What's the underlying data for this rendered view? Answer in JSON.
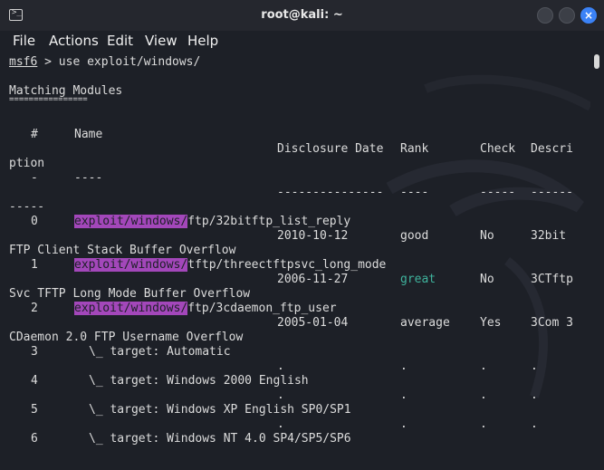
{
  "window": {
    "title": "root@kali: ~"
  },
  "menu": [
    "File",
    "Actions",
    "Edit",
    "View",
    "Help"
  ],
  "terminal": {
    "prompt": "msf6",
    "command": " > use exploit/windows/",
    "heading": "Matching Modules",
    "heading_rule": "================",
    "highlight": "exploit/windows/",
    "header1": [
      "#",
      "Name"
    ],
    "header2": [
      "Disclosure Date",
      "Rank",
      "Check",
      "Descri"
    ],
    "header_wrap": "ption",
    "dash_line1": "-",
    "dash_name": "----",
    "dash_date": "---------------",
    "dash_rank": "----",
    "dash_check": "-----",
    "dash_desc": "------",
    "dash_wrap": "-----",
    "modules": [
      {
        "num": "0",
        "path_rest": "ftp/32bitftp_list_reply",
        "date": "2010-10-12",
        "rank": "good",
        "check": "No",
        "desc": "32bit",
        "wrap": "FTP Client Stack Buffer Overflow"
      },
      {
        "num": "1",
        "path_rest": "tftp/threectftpsvc_long_mode",
        "date": "2006-11-27",
        "rank": "great",
        "check": "No",
        "desc": "3CTftp",
        "wrap": "Svc TFTP Long Mode Buffer Overflow"
      },
      {
        "num": "2",
        "path_rest": "ftp/3cdaemon_ftp_user",
        "date": "2005-01-04",
        "rank": "average",
        "check": "Yes",
        "desc": "3Com 3",
        "wrap": "CDaemon 2.0 FTP Username Overflow"
      }
    ],
    "targets": [
      {
        "num": "3",
        "text": "\\_ target: Automatic"
      },
      {
        "num": "4",
        "text": "\\_ target: Windows 2000 English"
      },
      {
        "num": "5",
        "text": "\\_ target: Windows XP English SP0/SP1"
      },
      {
        "num": "6",
        "text": "\\_ target: Windows NT 4.0 SP4/SP5/SP6"
      }
    ],
    "dot": "."
  },
  "colors": {
    "background": "#1d2027",
    "highlight": "#a347ba",
    "great": "#3fb39d",
    "close_button": "#3b82f6"
  }
}
